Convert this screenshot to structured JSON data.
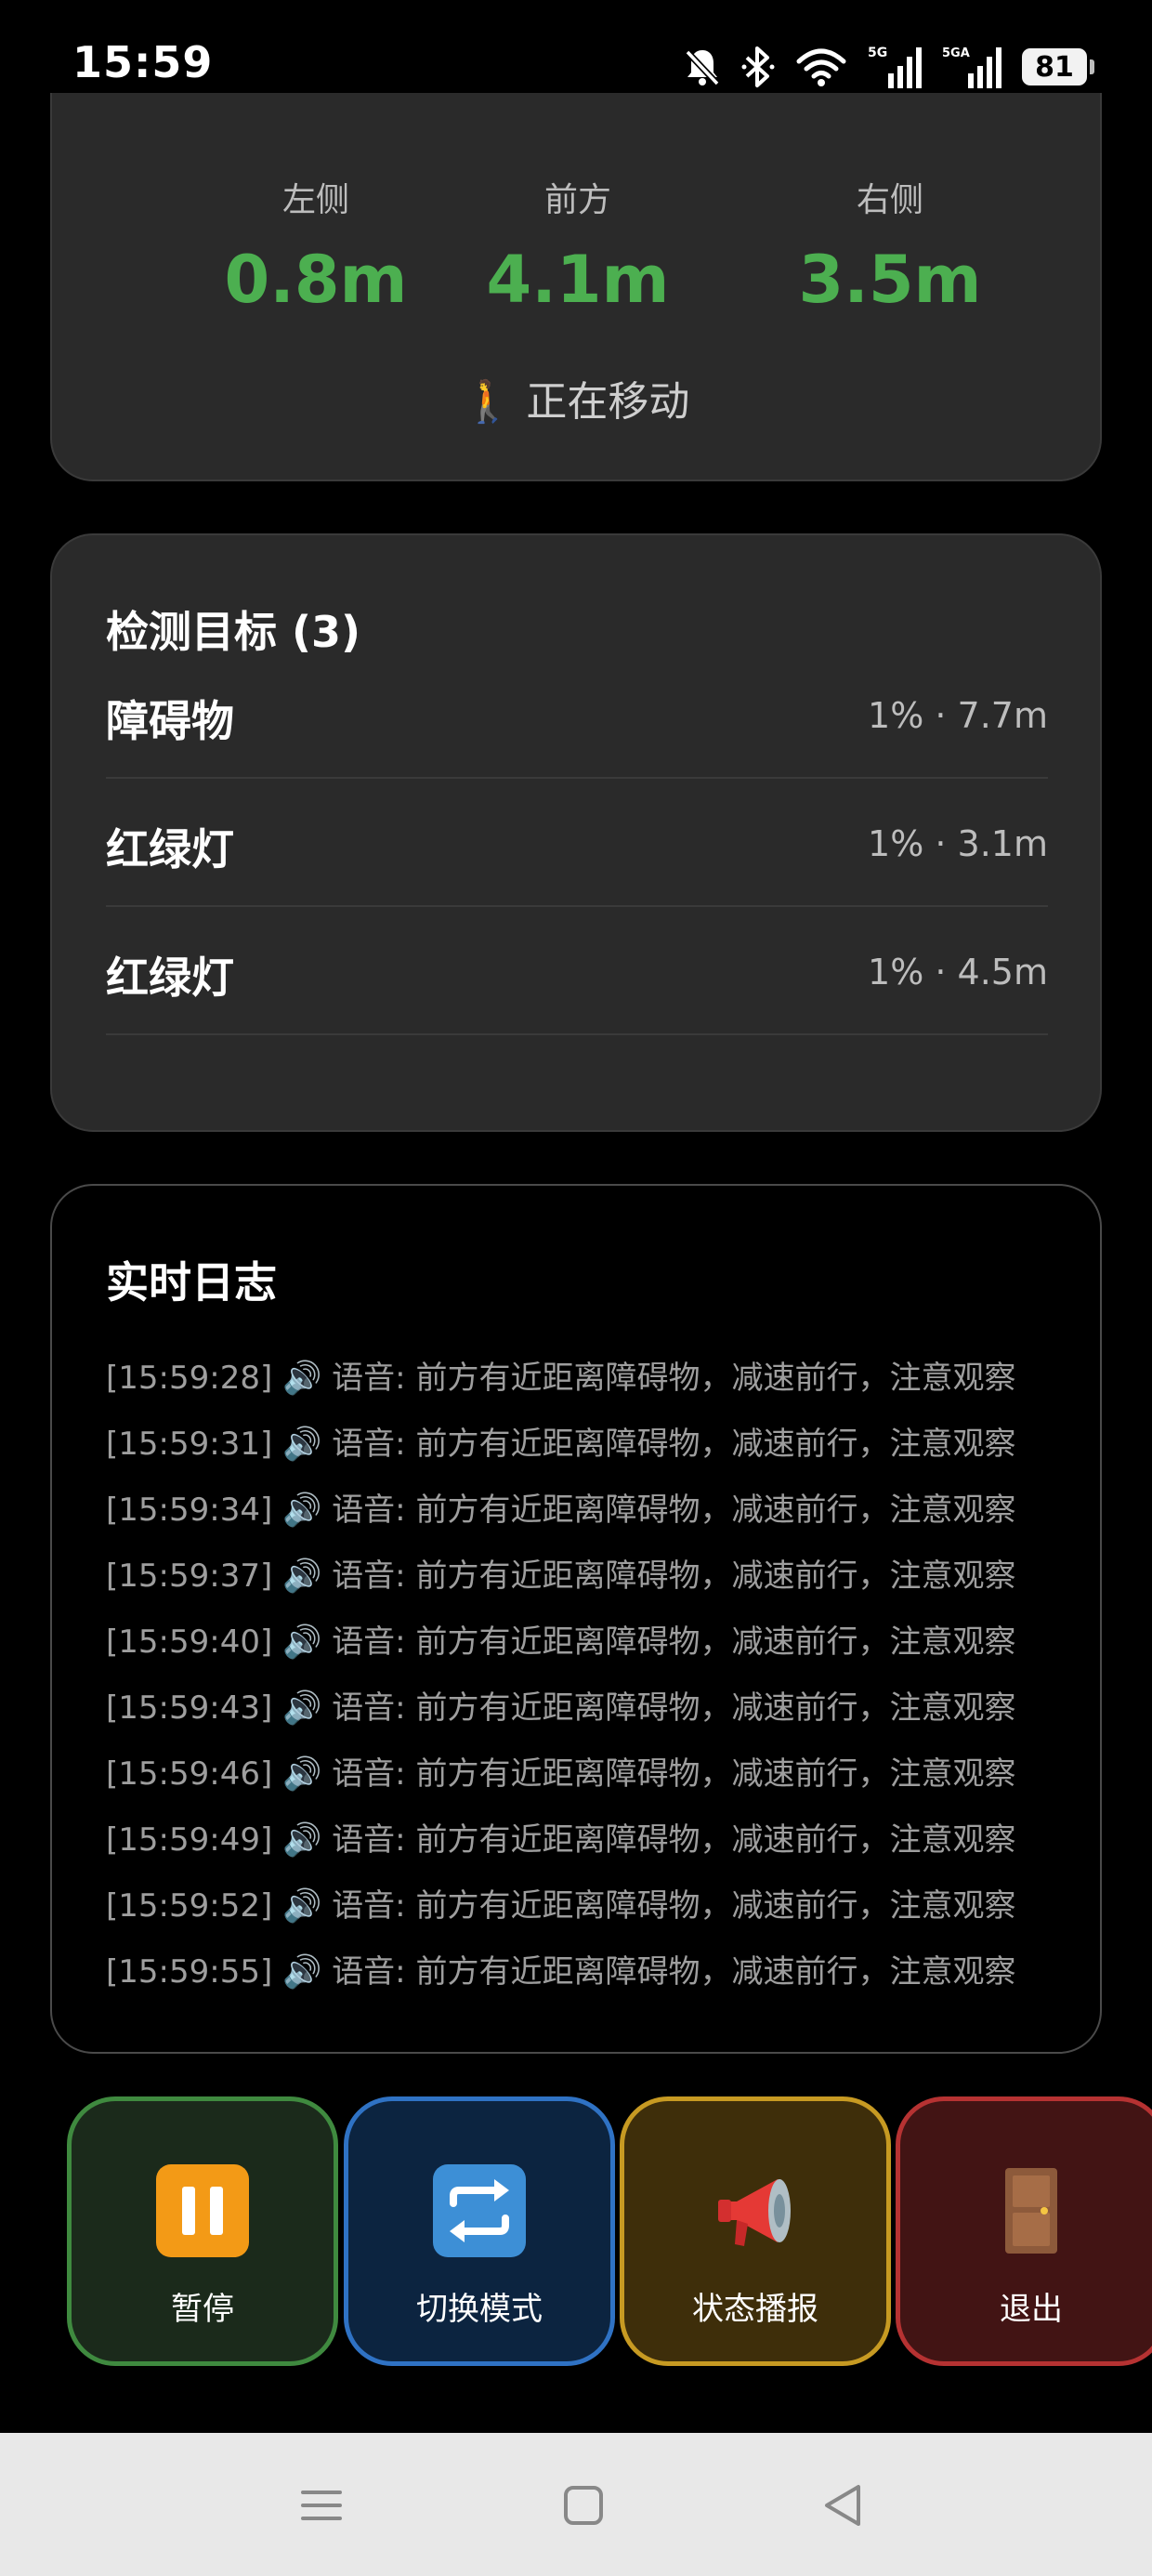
{
  "status_bar": {
    "time": "15:59",
    "battery": "81",
    "signal_1_label": "5G",
    "signal_2_label": "5GA"
  },
  "distance": {
    "left": {
      "label": "左侧",
      "value": "0.8m"
    },
    "front": {
      "label": "前方",
      "value": "4.1m"
    },
    "right": {
      "label": "右侧",
      "value": "3.5m"
    },
    "status_icon": "🚶",
    "status_text": "正在移动"
  },
  "targets": {
    "title": "检测目标 (3)",
    "items": [
      {
        "name": "障碍物",
        "meta": "1% · 7.7m"
      },
      {
        "name": "红绿灯",
        "meta": "1% · 3.1m"
      },
      {
        "name": "红绿灯",
        "meta": "1% · 4.5m"
      }
    ]
  },
  "log": {
    "title": "实时日志",
    "lines": [
      "[15:59:28] 🔊 语音: 前方有近距离障碍物，减速前行，注意观察",
      "[15:59:31] 🔊 语音: 前方有近距离障碍物，减速前行，注意观察",
      "[15:59:34] 🔊 语音: 前方有近距离障碍物，减速前行，注意观察",
      "[15:59:37] 🔊 语音: 前方有近距离障碍物，减速前行，注意观察",
      "[15:59:40] 🔊 语音: 前方有近距离障碍物，减速前行，注意观察",
      "[15:59:43] 🔊 语音: 前方有近距离障碍物，减速前行，注意观察",
      "[15:59:46] 🔊 语音: 前方有近距离障碍物，减速前行，注意观察",
      "[15:59:49] 🔊 语音: 前方有近距离障碍物，减速前行，注意观察",
      "[15:59:52] 🔊 语音: 前方有近距离障碍物，减速前行，注意观察",
      "[15:59:55] 🔊 语音: 前方有近距离障碍物，减速前行，注意观察"
    ]
  },
  "actions": {
    "pause": {
      "label": "暂停",
      "icon": "pause-icon",
      "color": "#3f8a3f"
    },
    "switch_mode": {
      "label": "切换模式",
      "icon": "repeat-arrows-icon",
      "color": "#2f72c4"
    },
    "status_report": {
      "label": "状态播报",
      "icon": "megaphone-icon",
      "color": "#c79a22"
    },
    "exit": {
      "label": "退出",
      "icon": "door-icon",
      "color": "#b63232"
    }
  },
  "colors": {
    "distance_value": "#4caf50",
    "card_background": "#2a2a2a",
    "page_background": "#000000"
  }
}
